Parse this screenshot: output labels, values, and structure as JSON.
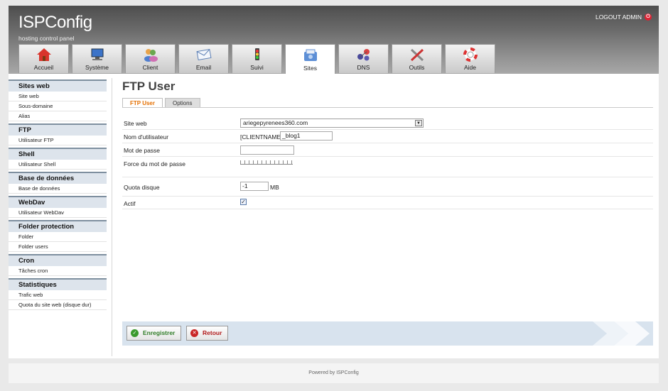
{
  "header": {
    "logo": "ISPConfig",
    "subtitle": "hosting control panel",
    "logout": "LOGOUT ADMIN"
  },
  "nav": {
    "tabs": [
      {
        "label": "Accueil",
        "icon": "home-icon"
      },
      {
        "label": "Système",
        "icon": "system-icon"
      },
      {
        "label": "Client",
        "icon": "client-icon"
      },
      {
        "label": "Email",
        "icon": "email-icon"
      },
      {
        "label": "Suivi",
        "icon": "monitor-icon"
      },
      {
        "label": "Sites",
        "icon": "sites-icon"
      },
      {
        "label": "DNS",
        "icon": "dns-icon"
      },
      {
        "label": "Outils",
        "icon": "tools-icon"
      },
      {
        "label": "Aide",
        "icon": "help-icon"
      }
    ],
    "active": "Sites"
  },
  "sidebar": {
    "groups": [
      {
        "title": "Sites web",
        "items": [
          "Site web",
          "Sous-domaine",
          "Alias"
        ]
      },
      {
        "title": "FTP",
        "items": [
          "Utilisateur FTP"
        ]
      },
      {
        "title": "Shell",
        "items": [
          "Utilisateur Shell"
        ]
      },
      {
        "title": "Base de données",
        "items": [
          "Base de données"
        ]
      },
      {
        "title": "WebDav",
        "items": [
          "Utilisateur WebDav"
        ]
      },
      {
        "title": "Folder protection",
        "items": [
          "Folder",
          "Folder users"
        ]
      },
      {
        "title": "Cron",
        "items": [
          "Tâches cron"
        ]
      },
      {
        "title": "Statistiques",
        "items": [
          "Trafic web",
          "Quota du site web (disque dur)"
        ]
      }
    ]
  },
  "content": {
    "title": "FTP User",
    "subtabs": [
      "FTP User",
      "Options"
    ],
    "form": {
      "site_web_label": "Site web",
      "site_web_value": "ariegepyrenees360.com",
      "username_label": "Nom d'utilisateur",
      "username_prefix": "[CLIENTNAME]",
      "username_value": "_blog1",
      "password_label": "Mot de passe",
      "password_value": "",
      "strength_label": "Force du mot de passe",
      "quota_label": "Quota disque",
      "quota_value": "-1",
      "quota_unit": "MB",
      "active_label": "Actif",
      "active_checked": true
    },
    "buttons": {
      "save": "Enregistrer",
      "back": "Retour"
    }
  },
  "footer": {
    "text": "Powered by ISPConfig"
  },
  "colors": {
    "accent_orange": "#e46f00",
    "sidebar_header": "#dde4ec",
    "button_bar": "#d8e3ee"
  }
}
